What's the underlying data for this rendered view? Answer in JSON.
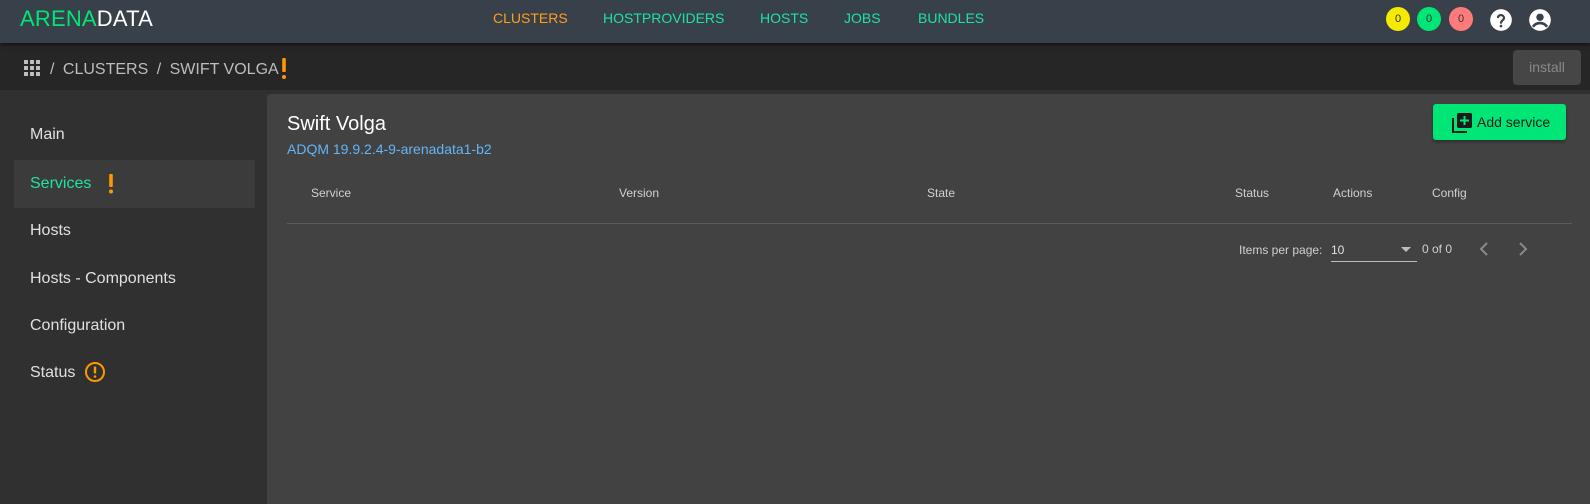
{
  "header": {
    "logo_part1": "ARENA",
    "logo_part2": "DATA",
    "nav": [
      {
        "label": "CLUSTERS",
        "active": true
      },
      {
        "label": "HOSTPROVIDERS",
        "active": false
      },
      {
        "label": "HOSTS",
        "active": false
      },
      {
        "label": "JOBS",
        "active": false
      },
      {
        "label": "BUNDLES",
        "active": false
      }
    ],
    "counters": [
      {
        "value": "0",
        "color": "#f5eb00"
      },
      {
        "value": "0",
        "color": "#00e676"
      },
      {
        "value": "0",
        "color": "#ff7b7b"
      }
    ],
    "icons": [
      "help-icon",
      "account-icon"
    ]
  },
  "breadcrumb": {
    "sep": "/",
    "items": [
      "CLUSTERS",
      "SWIFT VOLGA"
    ],
    "warning_color": "#ff9800",
    "action_label": "install"
  },
  "sidebar": {
    "items": [
      {
        "label": "Main",
        "active": false
      },
      {
        "label": "Services",
        "active": true,
        "warning": true
      },
      {
        "label": "Hosts",
        "active": false
      },
      {
        "label": "Hosts - Components",
        "active": false
      },
      {
        "label": "Configuration",
        "active": false
      },
      {
        "label": "Status",
        "active": false,
        "warning_circle": true
      }
    ]
  },
  "main": {
    "title": "Swift Volga",
    "bundle": "ADQM 19.9.2.4-9-arenadata1-b2",
    "add_button": "Add service",
    "columns": [
      "Service",
      "Version",
      "State",
      "Status",
      "Actions",
      "Config"
    ],
    "paginator": {
      "label": "Items per page:",
      "page_size": "10",
      "range": "0 of 0"
    }
  },
  "colors": {
    "accent": "#00e676",
    "nav_link": "#1ee3a0",
    "active_nav": "#ff9f1a",
    "link": "#64b5f6"
  }
}
